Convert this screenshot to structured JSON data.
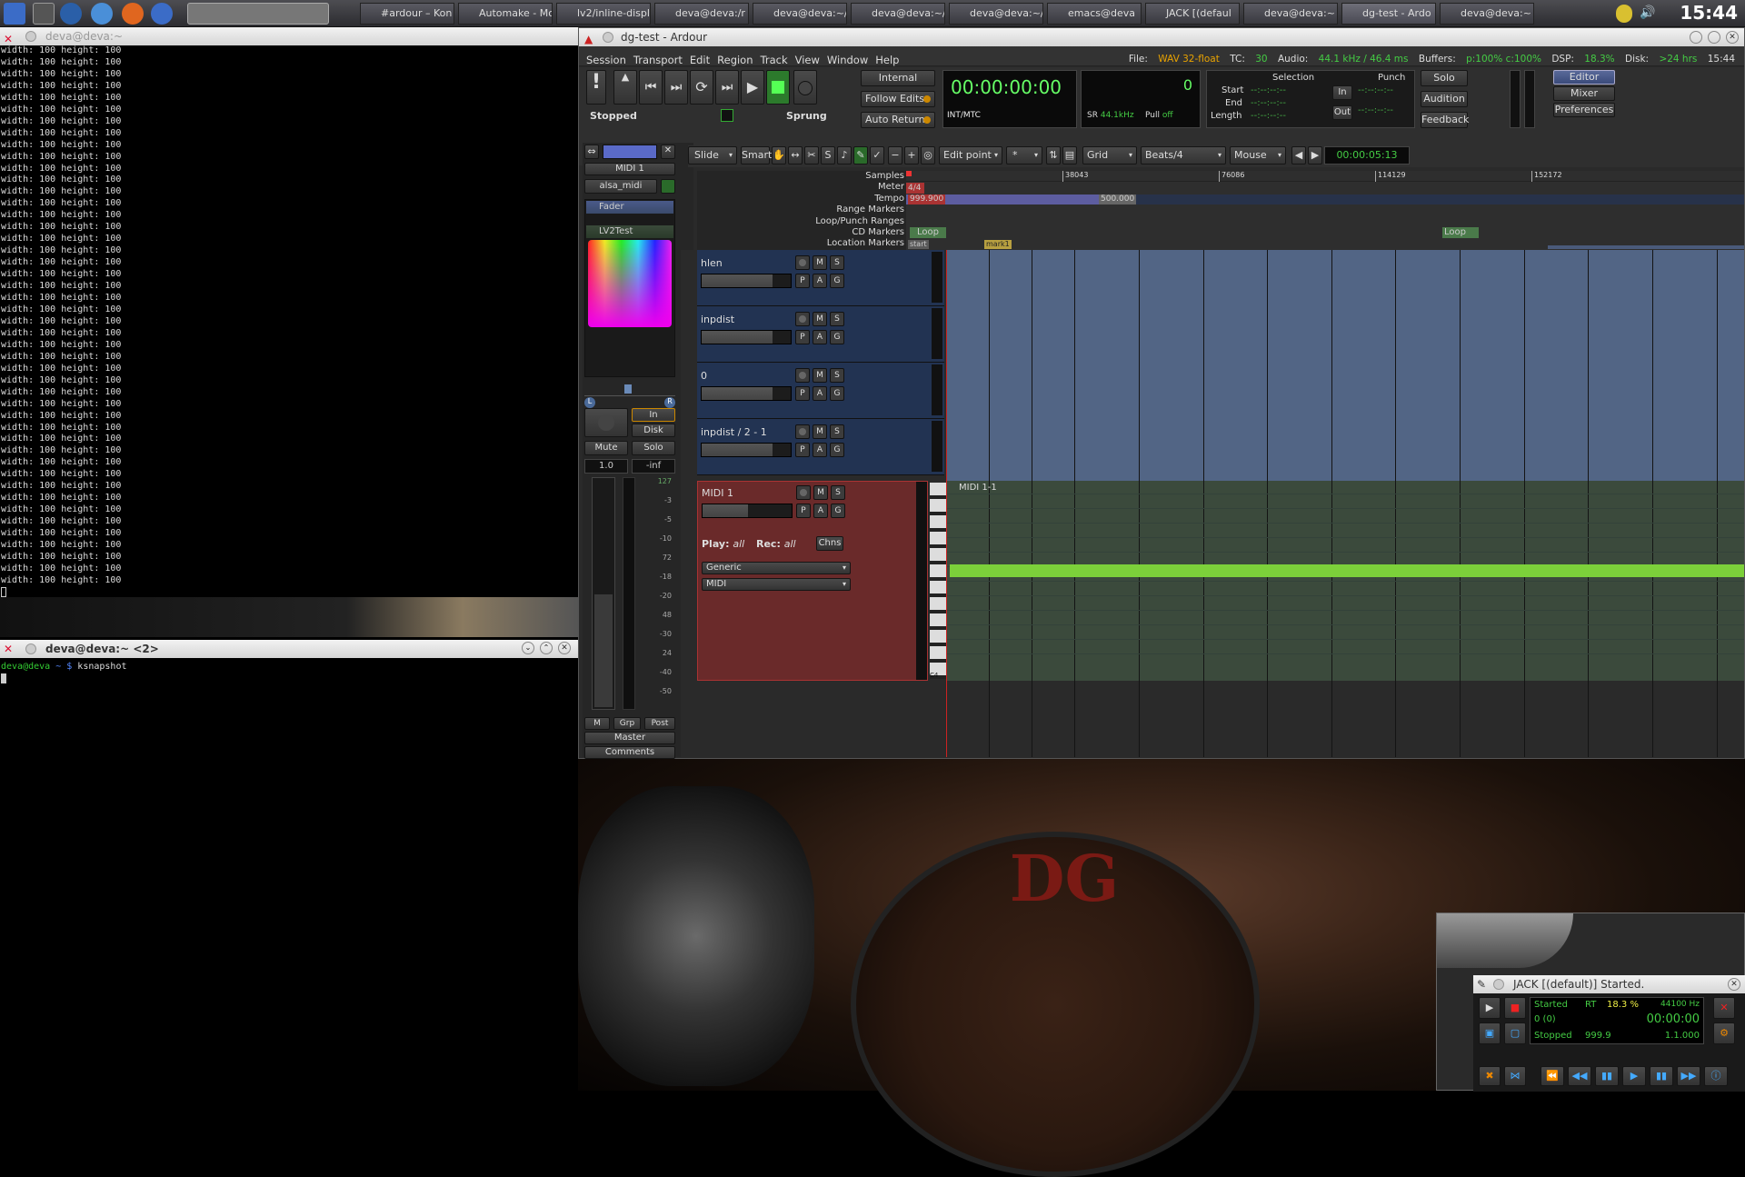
{
  "taskbar": {
    "tasks": [
      "#ardour – Kon",
      "Automake - Mo",
      "lv2/inline-displ",
      "deva@deva:/r",
      "deva@deva:~/",
      "deva@deva:~/",
      "deva@deva:~/",
      "emacs@deva",
      "JACK [(defaul",
      "deva@deva:~",
      "dg-test - Ardo",
      "deva@deva:~"
    ],
    "clock": "15:44"
  },
  "term1": {
    "title": "deva@deva:~",
    "line": "width: 100 height: 100"
  },
  "term2": {
    "title": "deva@deva:~ <2>",
    "prompt_user": "deva@deva",
    "prompt_rest": " ~ $ ",
    "command": "ksnapshot"
  },
  "ardour": {
    "title": "dg-test - Ardour",
    "menu": [
      "Session",
      "Transport",
      "Edit",
      "Region",
      "Track",
      "View",
      "Window",
      "Help"
    ],
    "status": {
      "file_lbl": "File:",
      "file": "WAV 32-float",
      "tc_lbl": "TC:",
      "tc": "30",
      "audio_lbl": "Audio:",
      "audio": "44.1 kHz / 46.4 ms",
      "buffers_lbl": "Buffers:",
      "buffers": "p:100% c:100%",
      "dsp_lbl": "DSP:",
      "dsp": "18.3%",
      "disk_lbl": "Disk:",
      "disk": ">24 hrs",
      "time": "15:44"
    },
    "transport": {
      "stopped": "Stopped",
      "sprung": "Sprung",
      "internal": "Internal",
      "follow": "Follow Edits",
      "autoreturn": "Auto Return",
      "clock": "00:00:00:00",
      "intmtc": "INT/MTC",
      "counter": "0",
      "sr_lbl": "SR",
      "sr": "44.1kHz",
      "pull_lbl": "Pull",
      "pull": "off"
    },
    "selection": {
      "title": "Selection",
      "punch": "Punch",
      "start": "Start",
      "end": "End",
      "length": "Length",
      "in": "In",
      "out": "Out",
      "dash": "--:--:--:--"
    },
    "right": {
      "solo": "Solo",
      "audition": "Audition",
      "feedback": "Feedback",
      "editor": "Editor",
      "mixer": "Mixer",
      "prefs": "Preferences"
    },
    "toolbar": {
      "slide": "Slide",
      "smart": "Smart",
      "editpoint": "Edit point",
      "star": "*",
      "grid": "Grid",
      "beats": "Beats/4",
      "mouse": "Mouse",
      "nudge": "00:00:05:13"
    },
    "rulers": [
      "Samples",
      "Meter",
      "Tempo",
      "Range Markers",
      "Loop/Punch Ranges",
      "CD Markers",
      "Location Markers"
    ],
    "ruler_ticks": [
      "38043",
      "76086",
      "114129",
      "152172"
    ],
    "meter": "4/4",
    "tempo1": "999.900",
    "tempo2": "500.000",
    "loop": "Loop",
    "start_marker": "start",
    "mark1": "mark1",
    "strip": {
      "name": "MIDI 1",
      "input": "alsa_midi",
      "fader": "Fader",
      "plugin": "LV2Test",
      "in": "In",
      "disk": "Disk",
      "mute": "Mute",
      "solo": "Solo",
      "gain": "1.0",
      "peak": "-inf",
      "m": "M",
      "grp": "Grp",
      "post": "Post",
      "master": "Master",
      "comments": "Comments",
      "scale": [
        "127",
        "-3",
        "-5",
        "-10",
        "72",
        "-18",
        "-20",
        "48",
        "-30",
        "24",
        "-40",
        "-50"
      ]
    },
    "tracks": [
      {
        "name": "hlen"
      },
      {
        "name": "inpdist"
      },
      {
        "name": "0"
      },
      {
        "name": "inpdist / 2 - 1"
      }
    ],
    "midi": {
      "name": "MIDI 1",
      "play": "Play:",
      "play_v": "all",
      "rec": "Rec:",
      "rec_v": "all",
      "chns": "Chns",
      "generic": "Generic",
      "midi": "MIDI",
      "region": "MIDI 1-1",
      "c4": "C4"
    },
    "btn": {
      "m": "M",
      "s": "S",
      "p": "P",
      "a": "A",
      "g": "G"
    }
  },
  "jack": {
    "title": "JACK [(default)] Started.",
    "started": "Started",
    "rt": "RT",
    "dsp": "18.3 %",
    "rate": "44100 Hz",
    "xruns": "0 (0)",
    "time": "00:00:00",
    "stopped": "Stopped",
    "tempo": "999.9",
    "bbt": "1.1.000"
  }
}
